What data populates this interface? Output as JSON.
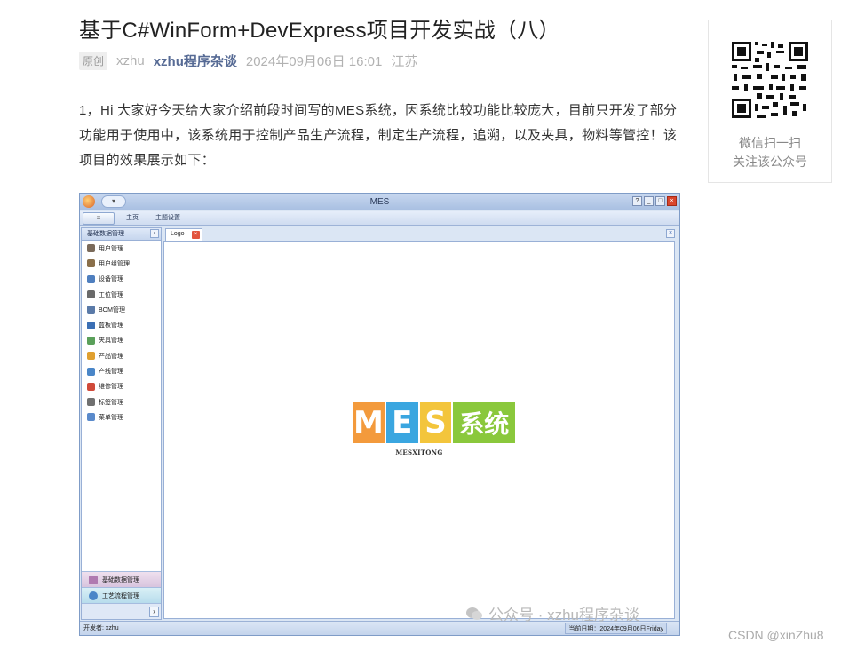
{
  "article": {
    "title": "基于C#WinForm+DevExpress项目开发实战（八）",
    "tag": "原创",
    "author": "xzhu",
    "account": "xzhu程序杂谈",
    "datetime": "2024年09月06日 16:01",
    "location": "江苏",
    "body": "1，Hi 大家好今天给大家介绍前段时间写的MES系统，因系统比较功能比较庞大，目前只开发了部分功能用于使用中，该系统用于控制产品生产流程，制定生产流程，追溯，以及夹具，物料等管控！该项目的效果展示如下："
  },
  "qr_card": {
    "line1": "微信扫一扫",
    "line2": "关注该公众号"
  },
  "app": {
    "window_title": "MES",
    "ribbon_tabs": [
      "主页",
      "主题设置"
    ],
    "sidebar_title": "基础数据管理",
    "sidebar_items": [
      {
        "label": "用户管理",
        "color": "#7a6a5a"
      },
      {
        "label": "用户组管理",
        "color": "#8a6f4a"
      },
      {
        "label": "设备管理",
        "color": "#4f7fbf"
      },
      {
        "label": "工位管理",
        "color": "#6a6a6a"
      },
      {
        "label": "BOM管理",
        "color": "#5a7aa8"
      },
      {
        "label": "盒板管理",
        "color": "#3b6fb5"
      },
      {
        "label": "夹具管理",
        "color": "#5aa05a"
      },
      {
        "label": "产品管理",
        "color": "#e0a030"
      },
      {
        "label": "产线管理",
        "color": "#4a86c8"
      },
      {
        "label": "维修管理",
        "color": "#d04a3a"
      },
      {
        "label": "标签管理",
        "color": "#707070"
      },
      {
        "label": "菜单管理",
        "color": "#5a8acb"
      }
    ],
    "nav_groups": [
      "基础数据管理",
      "工艺流程管理"
    ],
    "doc_tab": "Logo",
    "logo": {
      "letters": [
        "M",
        "E",
        "S",
        "系统"
      ],
      "colors": [
        "#f39a3c",
        "#3aa6e0",
        "#f3c53c",
        "#8ac83c"
      ],
      "subtitle": "MESXITONG"
    },
    "status": {
      "developer": "开发者:    xzhu",
      "date": "当前日期：2024年09月06日Friday"
    }
  },
  "watermark": "公众号 · xzhu程序杂谈",
  "csdn": "CSDN @xinZhu8"
}
